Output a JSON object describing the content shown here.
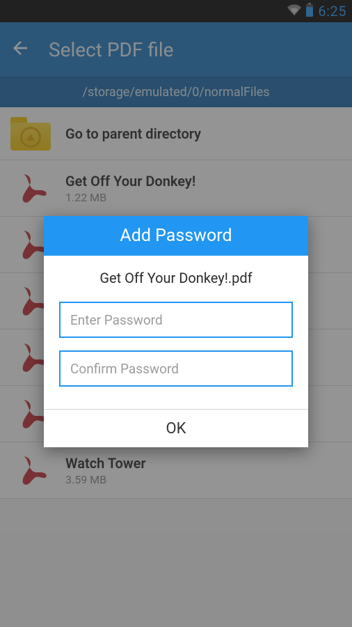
{
  "statusbar": {
    "time": "6:25"
  },
  "appbar": {
    "title": "Select PDF file"
  },
  "pathbar": {
    "path": "/storage/emulated/0/normalFiles"
  },
  "files": {
    "parent": {
      "label": "Go to parent directory"
    },
    "items": [
      {
        "name": "Get Off Your Donkey!",
        "size": "1.22 MB"
      },
      {
        "name": "",
        "size": ""
      },
      {
        "name": "",
        "size": ""
      },
      {
        "name": "",
        "size": ""
      },
      {
        "name": "",
        "size": ""
      },
      {
        "name": "Watch Tower",
        "size": "3.59 MB"
      }
    ]
  },
  "dialog": {
    "title": "Add Password",
    "filename": "Get Off Your Donkey!.pdf",
    "placeholder_pw": "Enter Password",
    "placeholder_confirm": "Confirm Password",
    "ok": "OK"
  }
}
